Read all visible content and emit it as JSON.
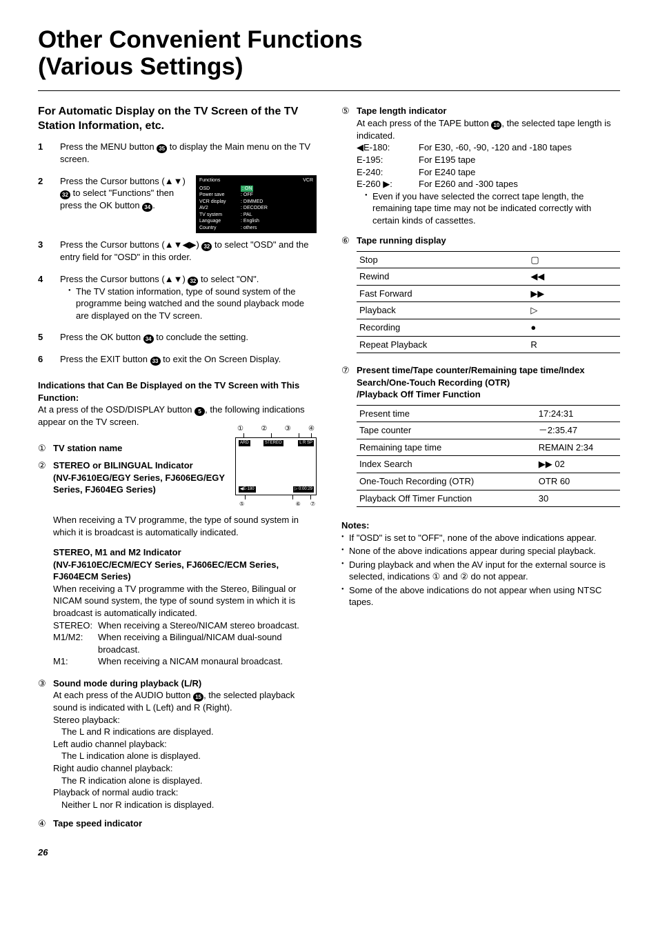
{
  "title_line1": "Other Convenient Functions",
  "title_line2": "(Various Settings)",
  "left": {
    "section_heading": "For Automatic Display on the TV Screen of the TV Station Information, etc.",
    "steps": [
      {
        "num": "1",
        "text_pre": "Press the MENU button ",
        "badge": "35",
        "text_post": " to display the Main menu on the TV screen."
      },
      {
        "num": "2",
        "text_pre": "Press the Cursor buttons (▲▼) ",
        "badge": "32",
        "text_mid": " to select \"Functions\" then press the OK button ",
        "badge2": "34",
        "text_post": "."
      },
      {
        "num": "3",
        "text_pre": "Press the Cursor buttons (▲▼◀▶) ",
        "badge": "32",
        "text_post": " to select \"OSD\" and the entry field for \"OSD\" in this order."
      },
      {
        "num": "4",
        "text_pre": "Press the Cursor buttons (▲▼) ",
        "badge": "32",
        "text_post": " to select \"ON\".",
        "bullet": "The TV station information, type of sound system of the programme being watched and the sound playback mode are displayed on the TV screen."
      },
      {
        "num": "5",
        "text_pre": "Press the OK button ",
        "badge": "34",
        "text_post": " to conclude the setting."
      },
      {
        "num": "6",
        "text_pre": "Press the EXIT button ",
        "badge": "33",
        "text_post": " to exit the On Screen Display."
      }
    ],
    "func_box": {
      "hdr_left": "Functions",
      "hdr_right": "VCR",
      "rows": [
        {
          "k": "OSD",
          "v": ": ON",
          "hl": true
        },
        {
          "k": "Power save",
          "v": ": OFF"
        },
        {
          "k": "VCR display",
          "v": ": DIMMED"
        },
        {
          "k": "AV2",
          "v": ": DECODER"
        },
        {
          "k": "TV system",
          "v": ": PAL"
        },
        {
          "k": "Language",
          "v": ": English"
        },
        {
          "k": "Country",
          "v": ": others"
        }
      ]
    },
    "indications_heading": "Indications that Can Be Displayed on the TV Screen with This Function:",
    "indications_text_pre": "At a press of the OSD/DISPLAY button ",
    "indications_badge": "5",
    "indications_text_post": ", the following indications appear on the TV screen.",
    "ind_box": {
      "top_nums": [
        "①",
        "②",
        "③",
        "④"
      ],
      "labels": {
        "ard": "ARD",
        "stereo": "STEREO",
        "lrsp": "L R  SP",
        "e180": "◀E-180",
        "time": "▷ 0:00:29"
      },
      "bot_nums": [
        "⑤",
        "⑥",
        "⑦"
      ]
    },
    "enum1_label": "①",
    "enum1_heading": "TV station name",
    "enum2_label": "②",
    "enum2_heading1": "STEREO or BILINGUAL Indicator",
    "enum2_heading2": "(NV-FJ610EG/EGY Series, FJ606EG/EGY Series, FJ604EG Series)",
    "enum2_text": "When receiving a TV programme, the type of sound system in which it is broadcast is automatically indicated.",
    "enum2b_heading1": "STEREO, M1 and M2 Indicator",
    "enum2b_heading2": "(NV-FJ610EC/ECM/ECY Series, FJ606EC/ECM Series, FJ604ECM Series)",
    "enum2b_text": "When receiving a TV programme with the Stereo, Bilingual or NICAM sound system, the type of sound system in which it is broadcast is automatically indicated.",
    "stereo_modes": [
      {
        "k": "STEREO:",
        "v": "When receiving a Stereo/NICAM stereo broadcast."
      },
      {
        "k": "M1/M2:",
        "v": "When receiving a Bilingual/NICAM dual-sound broadcast."
      },
      {
        "k": "M1:",
        "v": "When receiving a NICAM monaural broadcast."
      }
    ],
    "enum3_label": "③",
    "enum3_heading": "Sound mode during playback (L/R)",
    "enum3_text_pre": "At each press of the AUDIO button ",
    "enum3_badge": "15",
    "enum3_text_post": ", the selected playback sound is indicated with L (Left) and R (Right).",
    "enum3_rows": [
      {
        "lead": "Stereo playback:",
        "body": "The L and R indications are displayed."
      },
      {
        "lead": "Left audio channel playback:",
        "body": "The L indication alone is displayed."
      },
      {
        "lead": "Right audio channel playback:",
        "body": "The R indication alone is displayed."
      },
      {
        "lead": "Playback of normal audio track:",
        "body": "Neither L nor R indication is displayed."
      }
    ],
    "enum4_label": "④",
    "enum4_heading": "Tape speed indicator"
  },
  "right": {
    "enum5_label": "⑤",
    "enum5_heading": "Tape length indicator",
    "enum5_text_pre": "At each press of the TAPE button ",
    "enum5_badge": "10",
    "enum5_text_post": ", the selected tape length is indicated.",
    "enum5_rows": [
      {
        "k": "◀E-180:",
        "v": "For E30, -60, -90, -120 and -180 tapes"
      },
      {
        "k": "E-195:",
        "v": "For E195 tape"
      },
      {
        "k": "E-240:",
        "v": "For E240 tape"
      },
      {
        "k": "E-260 ▶:",
        "v": "For E260 and -300 tapes"
      }
    ],
    "enum5_bullet": "Even if you have selected the correct tape length, the remaining tape time may not be indicated correctly with certain kinds of cassettes.",
    "enum6_label": "⑥",
    "enum6_heading": "Tape running display",
    "enum6_table": [
      {
        "k": "Stop",
        "v": "▢"
      },
      {
        "k": "Rewind",
        "v": "◀◀"
      },
      {
        "k": "Fast Forward",
        "v": "▶▶"
      },
      {
        "k": "Playback",
        "v": "▷"
      },
      {
        "k": "Recording",
        "v": "●"
      },
      {
        "k": "Repeat Playback",
        "v": "R"
      }
    ],
    "enum7_label": "⑦",
    "enum7_heading1": "Present time/Tape counter/Remaining tape time/Index Search/One-Touch Recording (OTR)",
    "enum7_heading2": "/Playback Off Timer Function",
    "enum7_table": [
      {
        "k": "Present time",
        "v": "17:24:31"
      },
      {
        "k": "Tape counter",
        "v": "－2:35.47"
      },
      {
        "k": "Remaining tape time",
        "v": "REMAIN 2:34"
      },
      {
        "k": "Index Search",
        "v": "▶▶ 02"
      },
      {
        "k": "One-Touch Recording (OTR)",
        "v": "OTR 60"
      },
      {
        "k": "Playback Off Timer Function",
        "v": "30"
      }
    ],
    "notes_heading": "Notes:",
    "notes": [
      "If \"OSD\" is set to \"OFF\", none of the above indications appear.",
      "None of the above indications appear during special playback.",
      "During playback and when the AV input for the external source is selected, indications ① and ② do not appear.",
      "Some of the above indications do not appear when using NTSC tapes."
    ]
  },
  "page_number": "26"
}
